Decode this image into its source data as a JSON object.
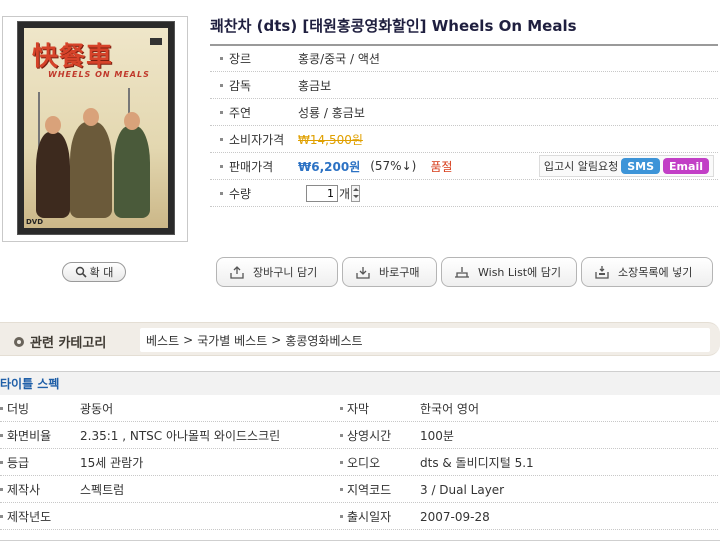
{
  "product": {
    "title": "쾌찬차 (dts) [태원홍콩영화할인] Wheels On Meals",
    "cover": {
      "title": "快餐車",
      "subtitle": "WHEELS ON MEALS",
      "dvd_mark": "DVD"
    },
    "zoom_label": "확 대"
  },
  "info": {
    "genre": {
      "label": "장르",
      "value": "홍콩/중국 / 액션"
    },
    "director": {
      "label": "감독",
      "value": "홍금보"
    },
    "cast": {
      "label": "주연",
      "value": "성룡 / 홍금보"
    },
    "list_price": {
      "label": "소비자가격",
      "value": "₩14,500원"
    },
    "sale_price": {
      "label": "판매가격",
      "value": "₩6,200원",
      "discount": "(57%↓)",
      "status": "품절",
      "notify_label": "입고시 알림요청",
      "sms_label": "SMS",
      "email_label": "Email"
    },
    "quantity": {
      "label": "수량",
      "value": "1",
      "unit": "개"
    }
  },
  "actions": {
    "cart": "장바구니 담기",
    "buy_now": "바로구매",
    "wishlist": "Wish List에 담기",
    "collection": "소장목록에 넣기"
  },
  "category": {
    "label": "관련 카테고리",
    "path": [
      "베스트",
      "국가별 베스트",
      "홍콩영화베스트"
    ],
    "separator": ">"
  },
  "spec": {
    "header": "타이틀 스펙",
    "rows": [
      {
        "l_label": "더빙",
        "l_value": "광동어",
        "r_label": "자막",
        "r_value": "한국어 영어"
      },
      {
        "l_label": "화면비율",
        "l_value": "2.35:1 , NTSC 아나몰픽 와이드스크린",
        "r_label": "상영시간",
        "r_value": "100분"
      },
      {
        "l_label": "등급",
        "l_value": "15세 관람가",
        "r_label": "오디오",
        "r_value": "dts & 돌비디지털 5.1"
      },
      {
        "l_label": "제작사",
        "l_value": "스펙트럼",
        "r_label": "지역코드",
        "r_value": "3 / Dual Layer"
      },
      {
        "l_label": "제작년도",
        "l_value": "",
        "r_label": "출시일자",
        "r_value": "2007-09-28"
      }
    ]
  },
  "colors": {
    "sale_price": "#2c72c4",
    "list_price": "#e0a000",
    "sold_out": "#d63a17",
    "sms_badge": "#3d94d8",
    "email_badge": "#c23fc6",
    "spec_header": "#1f5fa8"
  },
  "icons": {
    "zoom": "magnifier-icon",
    "cart": "cart-tray-icon",
    "buy_now": "download-tray-icon",
    "wishlist": "tray-icon",
    "collection": "collection-tray-icon"
  }
}
